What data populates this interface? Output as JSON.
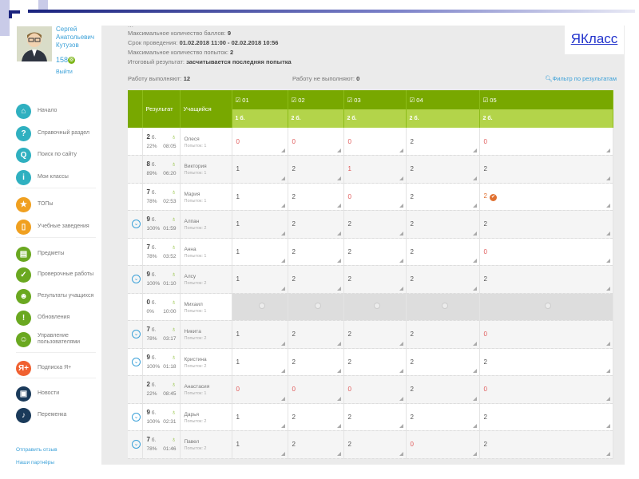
{
  "user": {
    "name": [
      "Сергей",
      "Анатольевич",
      "Кутузов"
    ],
    "score": "158",
    "logout": "Выйти"
  },
  "nav": [
    {
      "label": "Начало",
      "icon": "home-icon",
      "color": "#2fb0c0",
      "g": "⌂"
    },
    {
      "label": "Справочный раздел",
      "icon": "help-icon",
      "color": "#2fb0c0",
      "g": "?"
    },
    {
      "label": "Поиск по сайту",
      "icon": "search-icon",
      "color": "#2fb0c0",
      "g": "Q"
    },
    {
      "label": "Мои классы",
      "icon": "class-icon",
      "color": "#2fb0c0",
      "g": "i"
    },
    {
      "label": "ТОПы",
      "icon": "star-icon",
      "color": "#f0a020",
      "g": "★"
    },
    {
      "label": "Учебные заведения",
      "icon": "school-icon",
      "color": "#f0a020",
      "g": "▯"
    },
    {
      "label": "Предметы",
      "icon": "book-icon",
      "color": "#6aa820",
      "g": "▤"
    },
    {
      "label": "Проверочные работы",
      "icon": "check-icon",
      "color": "#6aa820",
      "g": "✓"
    },
    {
      "label": "Результаты учащихся",
      "icon": "users-icon",
      "color": "#6aa820",
      "g": "☻"
    },
    {
      "label": "Обновления",
      "icon": "exclamation-icon",
      "color": "#6aa820",
      "g": "!"
    },
    {
      "label": "Управление пользователями",
      "icon": "user-manage-icon",
      "color": "#6aa820",
      "g": "☺"
    },
    {
      "label": "Подписка Я+",
      "icon": "subscription-icon",
      "color": "#f06030",
      "g": "Я+"
    },
    {
      "label": "Новости",
      "icon": "news-icon",
      "color": "#1a3a5a",
      "g": "▣"
    },
    {
      "label": "Переменка",
      "icon": "bell-icon",
      "color": "#1a3a5a",
      "g": "♪"
    }
  ],
  "footer_links": [
    "Отправить отзыв",
    "Наши партнёры"
  ],
  "info": [
    {
      "label": "Максимальное количество баллов:",
      "value": "9"
    },
    {
      "label": "Срок проведения:",
      "value": "01.02.2018 11:00 - 02.02.2018 10:56"
    },
    {
      "label": "Максимальное количество попыток:",
      "value": "2"
    },
    {
      "label": "Итоговый результат:",
      "value": "засчитывается последняя попытка"
    }
  ],
  "logo": "ЯКласс",
  "stats": {
    "doing_label": "Работу выполняют:",
    "doing": "12",
    "notdoing_label": "Работу не выполняют:",
    "notdoing": "0",
    "filter": "Фильтр по результатам"
  },
  "table": {
    "headers": [
      "Результат",
      "Учащийся"
    ],
    "questions": [
      {
        "n": "☑ 01",
        "p": "1 б."
      },
      {
        "n": "☑ 02",
        "p": "2 б."
      },
      {
        "n": "☑ 03",
        "p": "2 б."
      },
      {
        "n": "☑ 04",
        "p": "2 б."
      },
      {
        "n": "☑ 05",
        "p": "2 б."
      }
    ],
    "rows": [
      {
        "pts": "2",
        "pct": "22%",
        "time": "08:05",
        "name": "Олеся",
        "att": "Попыток: 1",
        "exp": false,
        "q": [
          "0",
          "0",
          "0",
          "2",
          "0"
        ]
      },
      {
        "pts": "8",
        "pct": "89%",
        "time": "06:20",
        "name": "Виктория",
        "att": "Попыток: 1",
        "exp": false,
        "q": [
          "1",
          "2",
          "1r",
          "2",
          "2"
        ]
      },
      {
        "pts": "7",
        "pct": "78%",
        "time": "02:53",
        "name": "Мария",
        "att": "Попыток: 1",
        "exp": false,
        "q": [
          "1",
          "2",
          "0",
          "2",
          "2c"
        ]
      },
      {
        "pts": "9",
        "pct": "100%",
        "time": "01:59",
        "name": "Алпан",
        "att": "Попыток: 2",
        "exp": true,
        "q": [
          "1",
          "2",
          "2",
          "2",
          "2"
        ]
      },
      {
        "pts": "7",
        "pct": "78%",
        "time": "03:52",
        "name": "Анна",
        "att": "Попыток: 1",
        "exp": false,
        "q": [
          "1",
          "2",
          "2",
          "2",
          "0"
        ]
      },
      {
        "pts": "9",
        "pct": "100%",
        "time": "01:10",
        "name": "Алсу",
        "att": "Попыток: 2",
        "exp": true,
        "q": [
          "1",
          "2",
          "2",
          "2",
          "2"
        ]
      },
      {
        "pts": "0",
        "pct": "0%",
        "time": "10:00",
        "name": "Михаил",
        "att": "Попыток: 1",
        "exp": false,
        "na": true,
        "q": [
          "",
          "",
          "",
          "",
          ""
        ]
      },
      {
        "pts": "7",
        "pct": "78%",
        "time": "03:17",
        "name": "Никита",
        "att": "Попыток: 2",
        "exp": true,
        "q": [
          "1",
          "2",
          "2",
          "2",
          "0"
        ]
      },
      {
        "pts": "9",
        "pct": "100%",
        "time": "01:18",
        "name": "Кристина",
        "att": "Попыток: 2",
        "exp": true,
        "q": [
          "1",
          "2",
          "2",
          "2",
          "2"
        ]
      },
      {
        "pts": "2",
        "pct": "22%",
        "time": "08:45",
        "name": "Анастасия",
        "att": "Попыток: 1",
        "exp": false,
        "q": [
          "0",
          "0",
          "0",
          "2",
          "0"
        ]
      },
      {
        "pts": "9",
        "pct": "100%",
        "time": "02:31",
        "name": "Дарья",
        "att": "Попыток: 2",
        "exp": true,
        "q": [
          "1",
          "2",
          "2",
          "2",
          "2"
        ]
      },
      {
        "pts": "7",
        "pct": "78%",
        "time": "01:46",
        "name": "Павел",
        "att": "Попыток: 2",
        "exp": true,
        "q": [
          "1",
          "2",
          "2",
          "0",
          "2"
        ]
      }
    ],
    "points_unit": "б."
  }
}
